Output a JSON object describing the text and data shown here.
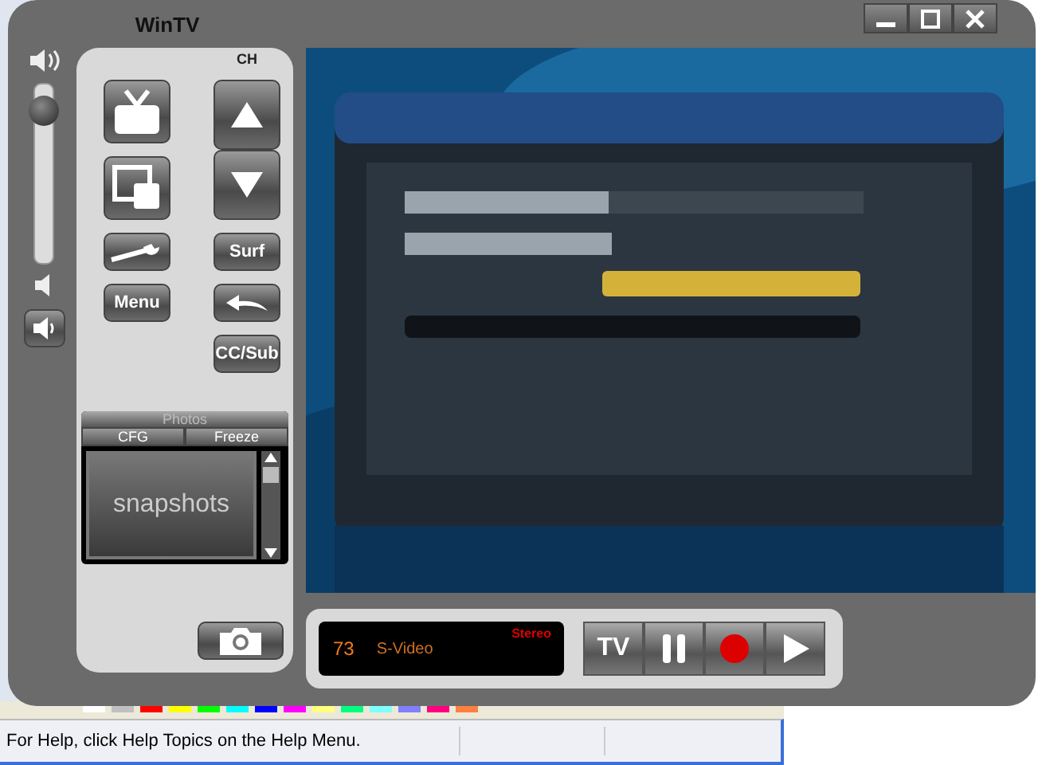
{
  "window": {
    "title": "WinTV"
  },
  "volume": {
    "level": 0.85
  },
  "channel_label": "CH",
  "panel_buttons": {
    "surf": "Surf",
    "menu": "Menu",
    "captions": "CC/Sub"
  },
  "photos": {
    "title": "Photos",
    "tabs": [
      "CFG",
      "Freeze"
    ],
    "placeholder": "snapshots"
  },
  "display": {
    "channel": "73",
    "source": "S-Video",
    "audio": "Stereo"
  },
  "transport": {
    "tv": "TV"
  },
  "status_bar": {
    "text": "For Help, click Help Topics on the Help Menu."
  }
}
